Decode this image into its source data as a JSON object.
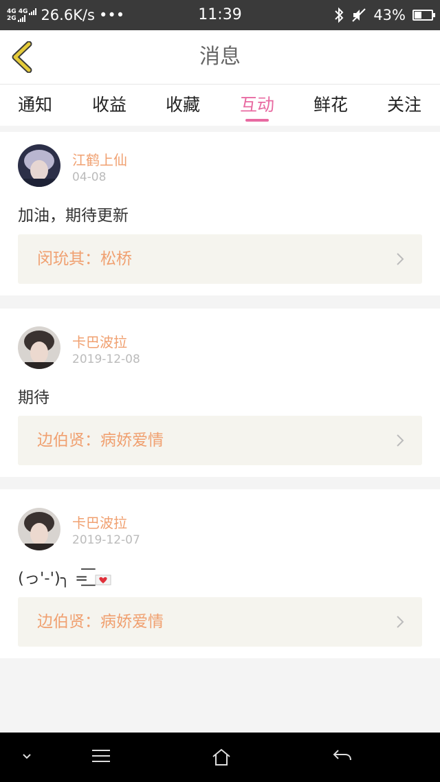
{
  "status_bar": {
    "signal_top": "4G 4G",
    "signal_bottom": "2G",
    "net_speed": "26.6K/s",
    "dots": "•••",
    "time": "11:39",
    "battery": "43%",
    "battery_level": 0.43,
    "icons": [
      "bluetooth-icon",
      "mute-icon",
      "battery-icon"
    ]
  },
  "nav": {
    "title": "消息",
    "back_icon": "back-chevron-icon",
    "accent": "#e5cb3a"
  },
  "tabs": [
    {
      "label": "通知",
      "active": false
    },
    {
      "label": "收益",
      "active": false
    },
    {
      "label": "收藏",
      "active": false
    },
    {
      "label": "互动",
      "active": true
    },
    {
      "label": "鲜花",
      "active": false
    },
    {
      "label": "关注",
      "active": false
    }
  ],
  "messages": [
    {
      "user": "江鹤上仙",
      "date": "04-08",
      "text": "加油，期待更新",
      "ref": "闵玧其：松桥"
    },
    {
      "user": "卡巴波拉",
      "date": "2019-12-08",
      "text": "期待",
      "ref": "边伯贤：病娇爱情"
    },
    {
      "user": "卡巴波拉",
      "date": "2019-12-07",
      "text": "(っ'-')╮ =͟͟͞͞",
      "ref": "边伯贤：病娇爱情"
    }
  ],
  "colors": {
    "accent_pink": "#e86aa1",
    "name_orange": "#f0a070",
    "ref_bg": "#f5f4ee"
  },
  "bottom_bar": [
    "chevron-down-icon",
    "menu-icon",
    "home-icon",
    "back-arrow-icon"
  ]
}
